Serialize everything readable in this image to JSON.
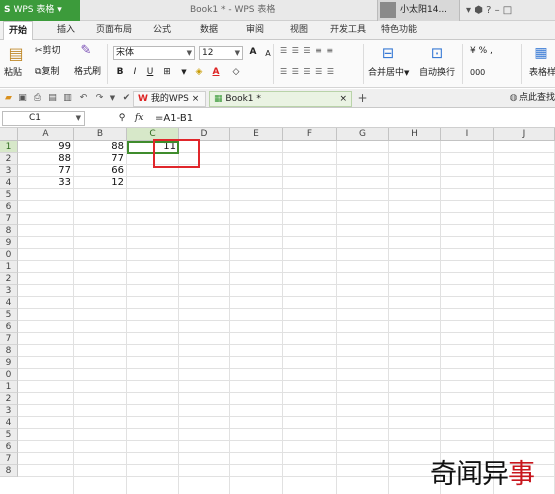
{
  "app": {
    "button_label": "WPS 表格",
    "window_title": "Book1 * - WPS 表格",
    "user_name": "小太阳14...",
    "window_icons": "▾ ⬢ ?  –  □"
  },
  "tabs": [
    "开始",
    "插入",
    "页面布局",
    "公式",
    "数据",
    "审阅",
    "视图",
    "开发工具",
    "特色功能"
  ],
  "ribbon": {
    "cut": "剪切",
    "copy": "复制",
    "paste": "粘贴",
    "format_painter": "格式刷",
    "font_name": "宋体",
    "font_size": "12",
    "bold": "B",
    "italic": "I",
    "underline": "U",
    "grow_font": "A",
    "shrink_font": "A",
    "merge_center": "合并居中",
    "wrap_text": "自动换行",
    "format": "表格样",
    "percent": "%",
    "thousands": "000"
  },
  "qab": {
    "doc_tab_home": "我的WPS",
    "doc_tab_book": "Book1 *",
    "find_text": "点此查找"
  },
  "formula_bar": {
    "cell_ref": "C1",
    "fx": "fx",
    "formula": "=A1-B1"
  },
  "sheet": {
    "columns": [
      "A",
      "B",
      "C",
      "D",
      "E",
      "F",
      "G",
      "H",
      "I",
      "J"
    ],
    "rows": [
      "1",
      "2",
      "3",
      "4",
      "5",
      "6",
      "7",
      "8",
      "9",
      "0",
      "1",
      "2",
      "3",
      "4",
      "5",
      "6",
      "7",
      "8",
      "9",
      "0",
      "1",
      "2",
      "3",
      "4",
      "5",
      "6",
      "7",
      "8"
    ],
    "cells": {
      "A1": "99",
      "B1": "88",
      "C1": "11",
      "A2": "88",
      "B2": "77",
      "A3": "77",
      "B3": "66",
      "A4": "33",
      "B4": "12"
    },
    "selected_cell": "C1"
  },
  "watermark": {
    "text1": "奇闻异",
    "text2": "事"
  },
  "colors": {
    "app_green": "#3c9b3b",
    "selection_green": "#3f8c2d",
    "highlight_red": "#e0262b"
  }
}
